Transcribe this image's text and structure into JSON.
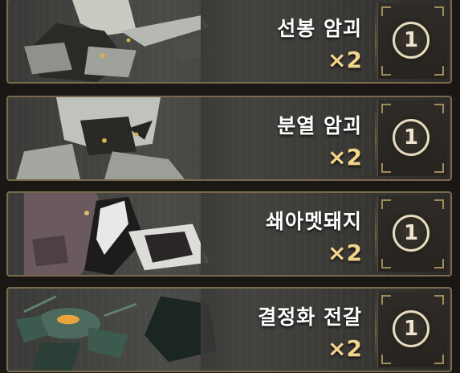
{
  "items": [
    {
      "name": "선봉 암괴",
      "count": "×2",
      "tier": "1",
      "palette": {
        "body": "#c9cbc2",
        "shadow": "#2b2a27",
        "accent": "#d8b24a"
      }
    },
    {
      "name": "분열 암괴",
      "count": "×2",
      "tier": "1",
      "palette": {
        "body": "#bfc3bb",
        "shadow": "#252421",
        "accent": "#d8b24a"
      }
    },
    {
      "name": "쇄아멧돼지",
      "count": "×2",
      "tier": "1",
      "palette": {
        "body": "#6a5a5e",
        "shadow": "#1e1b1c",
        "accent": "#e0c060"
      }
    },
    {
      "name": "결정화 전갈",
      "count": "×2",
      "tier": "1",
      "palette": {
        "body": "#4c6b5e",
        "shadow": "#1b2522",
        "accent": "#e9a33c"
      }
    }
  ],
  "colors": {
    "name_text": "#ffffff",
    "count_text": "#f2d58d",
    "card_border": "#7a6a4c",
    "tier_ring": "#e8dcc0"
  }
}
